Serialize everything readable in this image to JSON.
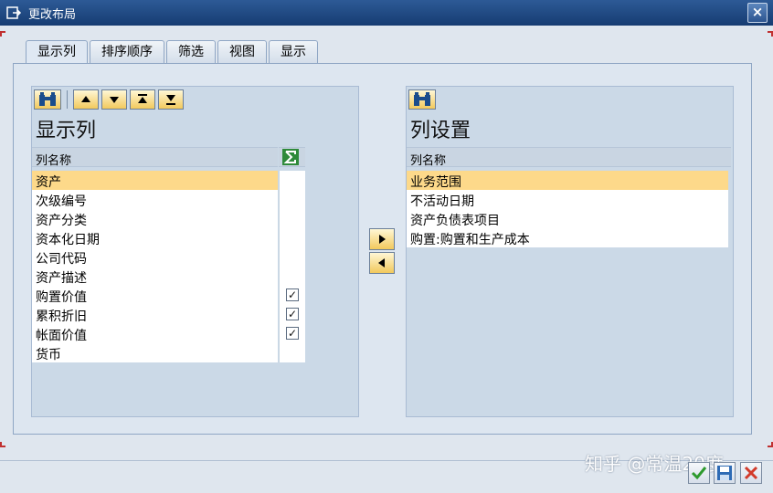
{
  "window": {
    "title": "更改布局",
    "close_label": "×"
  },
  "tabs": [
    {
      "label": "显示列"
    },
    {
      "label": "排序顺序"
    },
    {
      "label": "筛选"
    },
    {
      "label": "视图"
    },
    {
      "label": "显示"
    }
  ],
  "left_panel": {
    "title": "显示列",
    "column_header": "列名称",
    "sum_icon": "sigma-icon",
    "rows": [
      {
        "label": "资产",
        "selected": true,
        "checked": false
      },
      {
        "label": "次级编号",
        "checked": false
      },
      {
        "label": "资产分类",
        "checked": false
      },
      {
        "label": "资本化日期",
        "checked": false
      },
      {
        "label": "公司代码",
        "checked": false
      },
      {
        "label": "资产描述",
        "checked": false
      },
      {
        "label": "购置价值",
        "checked": true
      },
      {
        "label": "累积折旧",
        "checked": true
      },
      {
        "label": "帐面价值",
        "checked": true
      },
      {
        "label": "货币",
        "checked": false
      }
    ]
  },
  "right_panel": {
    "title": "列设置",
    "column_header": "列名称",
    "rows": [
      {
        "label": "业务范围",
        "selected": true
      },
      {
        "label": "不活动日期"
      },
      {
        "label": "资产负债表项目"
      },
      {
        "label": "购置:购置和生产成本"
      }
    ]
  },
  "watermark": "知乎 @常温20度",
  "colors": {
    "accent": "#2d5a96",
    "selection": "#fdd98a",
    "button": "#f2c95c"
  }
}
